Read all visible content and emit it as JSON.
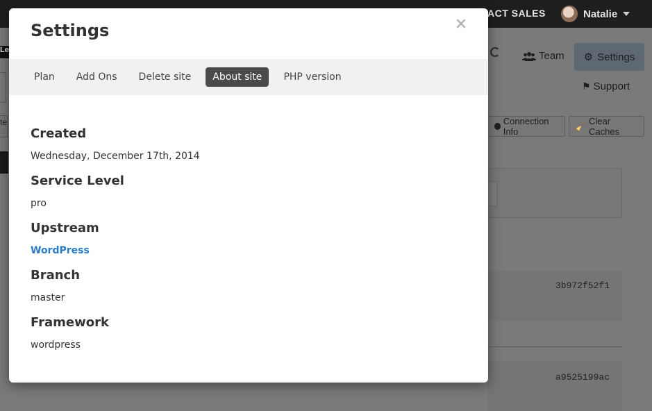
{
  "topbar": {
    "contact_sales": "ACT SALES",
    "user_name": "Natalie"
  },
  "background": {
    "left_chip_text": "Le",
    "left_chip2_text": "te",
    "team_label": "Team",
    "settings_label": "Settings",
    "support_label": "Support",
    "connection_info_label": "Connection Info",
    "clear_caches_label": "Clear Caches",
    "commit_hashes": [
      "3b972f52f1",
      "a9525199ac"
    ]
  },
  "modal": {
    "title": "Settings",
    "close_symbol": "×",
    "tabs": [
      {
        "label": "Plan",
        "active": false
      },
      {
        "label": "Add Ons",
        "active": false
      },
      {
        "label": "Delete site",
        "active": false
      },
      {
        "label": "About site",
        "active": true
      },
      {
        "label": "PHP version",
        "active": false
      }
    ],
    "fields": {
      "created": {
        "label": "Created",
        "value": "Wednesday, December 17th, 2014"
      },
      "service_level": {
        "label": "Service Level",
        "value": "pro"
      },
      "upstream": {
        "label": "Upstream",
        "value": "WordPress"
      },
      "branch": {
        "label": "Branch",
        "value": "master"
      },
      "framework": {
        "label": "Framework",
        "value": "wordpress"
      }
    }
  },
  "colors": {
    "active_tab": "#4a4a4a",
    "link": "#2a7ac4",
    "overlay_bg": "#7a7a7a"
  }
}
